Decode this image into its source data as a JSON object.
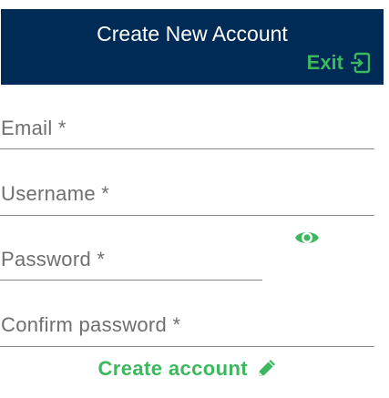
{
  "header": {
    "title": "Create New Account",
    "exit_label": "Exit",
    "exit_icon": "exit-icon"
  },
  "form": {
    "email_label": "Email  *",
    "username_label": "Username  *",
    "password_label": "Password  *",
    "confirm_label": "Confirm password  *",
    "show_password_icon": "eye-icon",
    "submit_label": "Create account",
    "submit_icon": "pencil-icon"
  },
  "colors": {
    "header_bg": "#002b57",
    "accent": "#3db85e",
    "label": "#6f6f6f",
    "underline": "#8a8a8a"
  }
}
